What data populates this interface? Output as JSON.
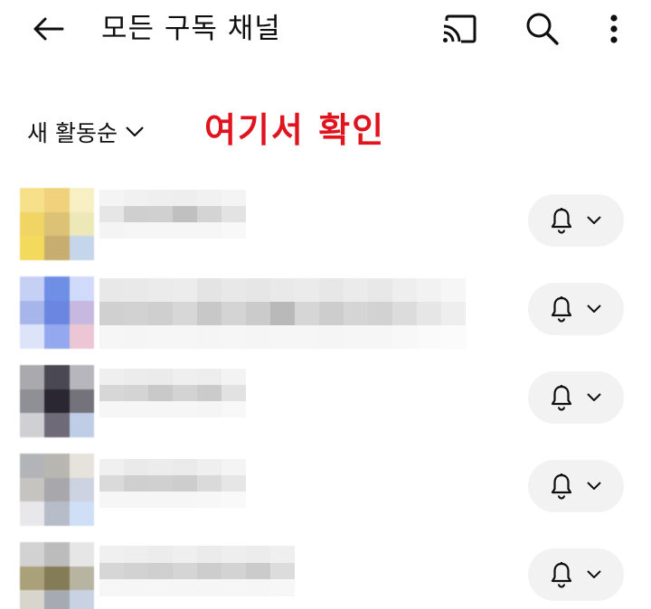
{
  "header": {
    "title": "모든 구독 채널",
    "back_icon": "arrow-left-icon",
    "cast_icon": "cast-icon",
    "search_icon": "search-icon",
    "more_icon": "more-vertical-icon"
  },
  "sort": {
    "label": "새 활동순",
    "icon": "chevron-down-icon"
  },
  "annotation": {
    "text": "여기서 확인",
    "color": "#e0141e"
  },
  "channels": [
    {
      "name": "",
      "bell_icon": "bell-icon",
      "dropdown_icon": "chevron-down-icon"
    },
    {
      "name": "",
      "bell_icon": "bell-icon",
      "dropdown_icon": "chevron-down-icon"
    },
    {
      "name": "",
      "bell_icon": "bell-icon",
      "dropdown_icon": "chevron-down-icon"
    },
    {
      "name": "",
      "bell_icon": "bell-icon",
      "dropdown_icon": "chevron-down-icon"
    },
    {
      "name": "",
      "bell_icon": "bell-icon",
      "dropdown_icon": "chevron-down-icon"
    }
  ]
}
